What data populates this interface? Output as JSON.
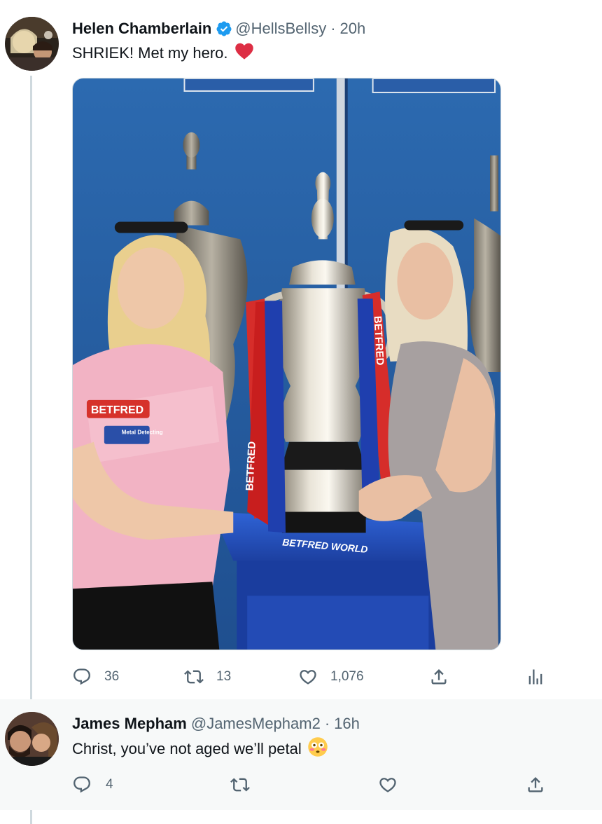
{
  "main_tweet": {
    "author_name": "Helen Chamberlain",
    "handle": "@HellsBellsy",
    "separator": "·",
    "time": "20h",
    "text": "SHRIEK! Met my hero.",
    "verified": true,
    "photo": {
      "banner_text": "BETFRED",
      "sponsor_text": "Metal Detecting",
      "plinth_text": "BETFRED WORLD"
    },
    "actions": {
      "reply_count": "36",
      "retweet_count": "13",
      "like_count": "1,076"
    }
  },
  "reply_tweet": {
    "author_name": "James Mepham",
    "handle": "@JamesMepham2",
    "separator": "·",
    "time": "16h",
    "text": "Christ, you’ve not aged we’ll petal",
    "actions": {
      "reply_count": "4"
    }
  },
  "colors": {
    "verified_blue": "#1d9bf0",
    "heart_red": "#e0245e",
    "secondary_text": "#536471",
    "reply_background": "#f7f9f9"
  },
  "icons": [
    "reply-icon",
    "retweet-icon",
    "like-icon",
    "share-icon",
    "analytics-icon",
    "verified-badge-icon"
  ]
}
